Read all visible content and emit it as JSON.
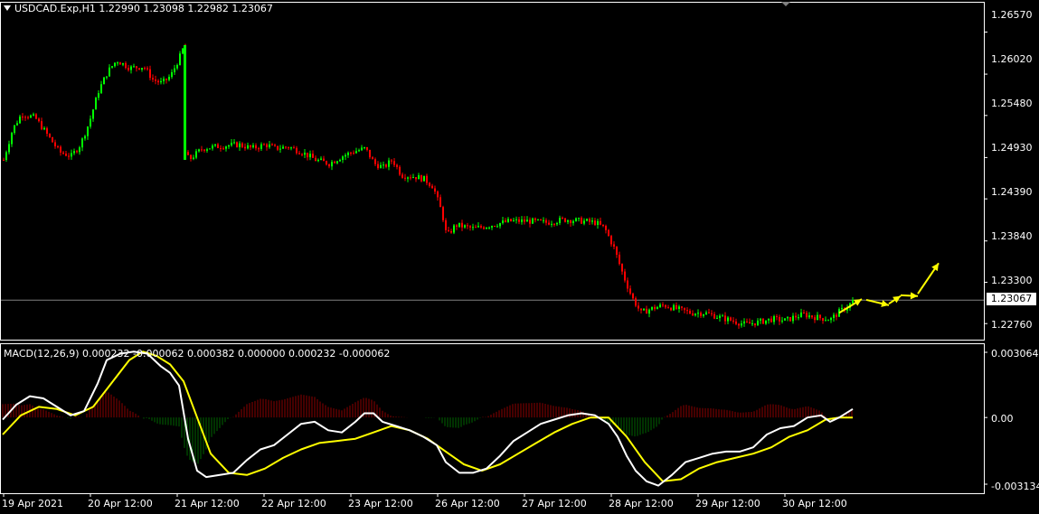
{
  "header": {
    "symbol_line": "USDCAD.Exp,H1  1.22990 1.23098 1.22982 1.23067"
  },
  "macd_header": {
    "text": "MACD(12,26,9) 0.000232 -0.000062 0.000382 0.000000 0.000232 -0.000062"
  },
  "price_axis": {
    "labels": [
      "1.26570",
      "1.26020",
      "1.25480",
      "1.24930",
      "1.24390",
      "1.23840",
      "1.23300",
      "1.22760"
    ],
    "current_price": "1.23067"
  },
  "macd_axis": {
    "labels": [
      "0.003064",
      "0.00",
      "-0.003134"
    ]
  },
  "time_axis": {
    "labels": [
      "19 Apr 2021",
      "20 Apr 12:00",
      "21 Apr 12:00",
      "22 Apr 12:00",
      "23 Apr 12:00",
      "26 Apr 12:00",
      "27 Apr 12:00",
      "28 Apr 12:00",
      "29 Apr 12:00",
      "30 Apr 12:00"
    ]
  },
  "colors": {
    "background": "#000000",
    "bull_candle": "#00ff00",
    "bear_candle": "#ff0000",
    "macd_line": "#ffffff",
    "signal_line": "#ffff00",
    "histogram_positive": "#8b0000",
    "histogram_negative": "#006400",
    "forecast_arrows": "#ffff00",
    "grid_line": "#808080"
  },
  "chart_data": [
    {
      "type": "candlestick",
      "symbol": "USDCAD.Exp",
      "timeframe": "H1",
      "ohlc_last": {
        "open": 1.2299,
        "high": 1.23098,
        "low": 1.22982,
        "close": 1.23067
      },
      "ylim": [
        1.2255,
        1.268
      ],
      "close_path": [
        [
          0,
          1.249
        ],
        [
          10,
          1.253
        ],
        [
          20,
          1.255
        ],
        [
          35,
          1.2545
        ],
        [
          50,
          1.252
        ],
        [
          62,
          1.25
        ],
        [
          75,
          1.2495
        ],
        [
          85,
          1.251
        ],
        [
          95,
          1.254
        ],
        [
          105,
          1.258
        ],
        [
          115,
          1.2605
        ],
        [
          125,
          1.262
        ],
        [
          140,
          1.261
        ],
        [
          155,
          1.2612
        ],
        [
          165,
          1.2595
        ],
        [
          175,
          1.259
        ],
        [
          185,
          1.26
        ],
        [
          195,
          1.2625
        ],
        [
          200,
          1.264
        ],
        [
          201,
          1.25
        ],
        [
          205,
          1.249
        ],
        [
          220,
          1.2505
        ],
        [
          240,
          1.2508
        ],
        [
          260,
          1.251
        ],
        [
          275,
          1.2505
        ],
        [
          290,
          1.251
        ],
        [
          300,
          1.2505
        ],
        [
          315,
          1.2507
        ],
        [
          330,
          1.25
        ],
        [
          345,
          1.249
        ],
        [
          360,
          1.2485
        ],
        [
          375,
          1.2495
        ],
        [
          385,
          1.25
        ],
        [
          400,
          1.2505
        ],
        [
          410,
          1.2485
        ],
        [
          420,
          1.248
        ],
        [
          430,
          1.249
        ],
        [
          440,
          1.247
        ],
        [
          455,
          1.2468
        ],
        [
          465,
          1.2465
        ],
        [
          475,
          1.2455
        ],
        [
          485,
          1.242
        ],
        [
          490,
          1.239
        ],
        [
          500,
          1.2405
        ],
        [
          520,
          1.24
        ],
        [
          540,
          1.2405
        ],
        [
          560,
          1.241
        ],
        [
          580,
          1.241
        ],
        [
          600,
          1.2408
        ],
        [
          620,
          1.2412
        ],
        [
          640,
          1.241
        ],
        [
          655,
          1.2408
        ],
        [
          665,
          1.24
        ],
        [
          675,
          1.2375
        ],
        [
          685,
          1.234
        ],
        [
          695,
          1.231
        ],
        [
          705,
          1.229
        ],
        [
          715,
          1.2295
        ],
        [
          730,
          1.23
        ],
        [
          745,
          1.2295
        ],
        [
          760,
          1.229
        ],
        [
          775,
          1.229
        ],
        [
          790,
          1.2285
        ],
        [
          805,
          1.228
        ],
        [
          820,
          1.2275
        ],
        [
          835,
          1.2278
        ],
        [
          850,
          1.2282
        ],
        [
          865,
          1.228
        ],
        [
          875,
          1.2285
        ],
        [
          885,
          1.2288
        ],
        [
          895,
          1.2285
        ],
        [
          905,
          1.2283
        ],
        [
          915,
          1.2282
        ],
        [
          925,
          1.2292
        ],
        [
          935,
          1.23
        ],
        [
          940,
          1.2307
        ]
      ]
    },
    {
      "type": "line",
      "name": "MACD(12,26,9)",
      "ylim": [
        -0.003134,
        0.003064
      ],
      "series": [
        {
          "role": "macd",
          "points": [
            [
              0,
              -0.0001
            ],
            [
              15,
              0.0006
            ],
            [
              30,
              0.001
            ],
            [
              45,
              0.0009
            ],
            [
              60,
              0.0005
            ],
            [
              75,
              0.0001
            ],
            [
              90,
              0.0003
            ],
            [
              105,
              0.0016
            ],
            [
              115,
              0.0027
            ],
            [
              130,
              0.003
            ],
            [
              145,
              0.0031
            ],
            [
              160,
              0.003
            ],
            [
              175,
              0.0024
            ],
            [
              185,
              0.0021
            ],
            [
              195,
              0.0015
            ],
            [
              205,
              -0.001
            ],
            [
              215,
              -0.0025
            ],
            [
              225,
              -0.0028
            ],
            [
              240,
              -0.0027
            ],
            [
              255,
              -0.0026
            ],
            [
              270,
              -0.002
            ],
            [
              285,
              -0.0015
            ],
            [
              300,
              -0.0013
            ],
            [
              315,
              -0.0008
            ],
            [
              330,
              -0.0003
            ],
            [
              345,
              -0.0002
            ],
            [
              360,
              -0.0006
            ],
            [
              375,
              -0.0007
            ],
            [
              390,
              -0.0002
            ],
            [
              400,
              0.0002
            ],
            [
              410,
              0.0002
            ],
            [
              420,
              -0.0002
            ],
            [
              435,
              -0.0004
            ],
            [
              450,
              -0.0006
            ],
            [
              465,
              -0.0009
            ],
            [
              480,
              -0.0013
            ],
            [
              490,
              -0.0021
            ],
            [
              505,
              -0.0026
            ],
            [
              520,
              -0.0026
            ],
            [
              535,
              -0.0024
            ],
            [
              550,
              -0.0018
            ],
            [
              565,
              -0.0011
            ],
            [
              580,
              -0.0007
            ],
            [
              595,
              -0.0003
            ],
            [
              610,
              -0.0001
            ],
            [
              625,
              0.0001
            ],
            [
              640,
              0.0002
            ],
            [
              655,
              0.0001
            ],
            [
              670,
              -0.0003
            ],
            [
              680,
              -0.0009
            ],
            [
              690,
              -0.0018
            ],
            [
              700,
              -0.0025
            ],
            [
              712,
              -0.003
            ],
            [
              725,
              -0.0032
            ],
            [
              740,
              -0.0027
            ],
            [
              755,
              -0.0021
            ],
            [
              770,
              -0.0019
            ],
            [
              785,
              -0.0017
            ],
            [
              800,
              -0.0016
            ],
            [
              815,
              -0.0016
            ],
            [
              830,
              -0.0014
            ],
            [
              845,
              -0.0008
            ],
            [
              860,
              -0.0005
            ],
            [
              875,
              -0.0004
            ],
            [
              890,
              0.0
            ],
            [
              905,
              0.0001
            ],
            [
              915,
              -0.0002
            ],
            [
              925,
              0.0
            ],
            [
              940,
              0.0004
            ]
          ]
        },
        {
          "role": "signal",
          "points": [
            [
              0,
              -0.0008
            ],
            [
              20,
              0.0001
            ],
            [
              40,
              0.0005
            ],
            [
              60,
              0.0004
            ],
            [
              80,
              0.0001
            ],
            [
              100,
              0.0005
            ],
            [
              120,
              0.0016
            ],
            [
              140,
              0.0027
            ],
            [
              155,
              0.0031
            ],
            [
              170,
              0.0029
            ],
            [
              185,
              0.0025
            ],
            [
              200,
              0.0017
            ],
            [
              215,
              0.0
            ],
            [
              230,
              -0.0017
            ],
            [
              250,
              -0.0026
            ],
            [
              270,
              -0.0027
            ],
            [
              290,
              -0.0024
            ],
            [
              310,
              -0.0019
            ],
            [
              330,
              -0.0015
            ],
            [
              350,
              -0.0012
            ],
            [
              370,
              -0.0011
            ],
            [
              390,
              -0.001
            ],
            [
              410,
              -0.0007
            ],
            [
              430,
              -0.0004
            ],
            [
              450,
              -0.0006
            ],
            [
              470,
              -0.001
            ],
            [
              490,
              -0.0016
            ],
            [
              510,
              -0.0022
            ],
            [
              530,
              -0.0025
            ],
            [
              550,
              -0.0022
            ],
            [
              570,
              -0.0017
            ],
            [
              590,
              -0.0012
            ],
            [
              610,
              -0.0007
            ],
            [
              630,
              -0.0003
            ],
            [
              650,
              0.0
            ],
            [
              670,
              0.0
            ],
            [
              690,
              -0.0009
            ],
            [
              710,
              -0.0021
            ],
            [
              730,
              -0.003
            ],
            [
              750,
              -0.0029
            ],
            [
              770,
              -0.0024
            ],
            [
              790,
              -0.0021
            ],
            [
              810,
              -0.0019
            ],
            [
              830,
              -0.0017
            ],
            [
              850,
              -0.0014
            ],
            [
              870,
              -0.0009
            ],
            [
              890,
              -0.0006
            ],
            [
              910,
              -0.0001
            ],
            [
              925,
              0.0
            ],
            [
              940,
              0.0
            ]
          ]
        }
      ]
    }
  ],
  "forecast_arrows": [
    [
      [
        925,
        1.229
      ],
      [
        950,
        1.2308
      ]
    ],
    [
      [
        955,
        1.2307
      ],
      [
        980,
        1.23
      ]
    ],
    [
      [
        980,
        1.2302
      ],
      [
        993,
        1.2312
      ]
    ],
    [
      [
        993,
        1.2313
      ],
      [
        1012,
        1.2312
      ]
    ],
    [
      [
        1012,
        1.2315
      ],
      [
        1035,
        1.2355
      ]
    ]
  ]
}
